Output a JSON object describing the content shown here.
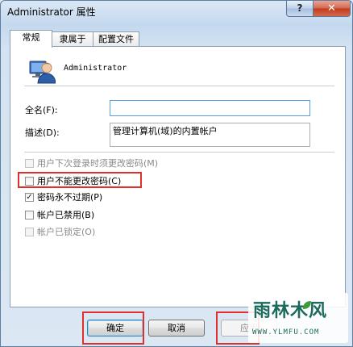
{
  "window": {
    "title": "Administrator 属性",
    "help_glyph": "?",
    "close_glyph": "✕"
  },
  "tabs": [
    {
      "label": "常规",
      "active": true
    },
    {
      "label": "隶属于",
      "active": false
    },
    {
      "label": "配置文件",
      "active": false
    }
  ],
  "general": {
    "user_icon": "user-account-icon",
    "user_name": "Administrator",
    "full_name_label": "全名(F):",
    "full_name_value": "",
    "description_label": "描述(D):",
    "description_value": "管理计算机(域)的内置帐户",
    "checkboxes": [
      {
        "label": "用户下次登录时须更改密码(M)",
        "checked": false,
        "enabled": false
      },
      {
        "label": "用户不能更改密码(C)",
        "checked": false,
        "enabled": true
      },
      {
        "label": "密码永不过期(P)",
        "checked": true,
        "enabled": true
      },
      {
        "label": "帐户已禁用(B)",
        "checked": false,
        "enabled": true
      },
      {
        "label": "帐户已锁定(O)",
        "checked": false,
        "enabled": false
      }
    ]
  },
  "buttons": {
    "ok": "确定",
    "cancel": "取消",
    "apply": "应用"
  },
  "watermark": {
    "text": "雨林木风",
    "url": "WWW.YLMFU.COM"
  },
  "colors": {
    "highlight_red": "#e0302c",
    "watermark_green": "#1c6b5c",
    "close_red": "#c4391b"
  }
}
